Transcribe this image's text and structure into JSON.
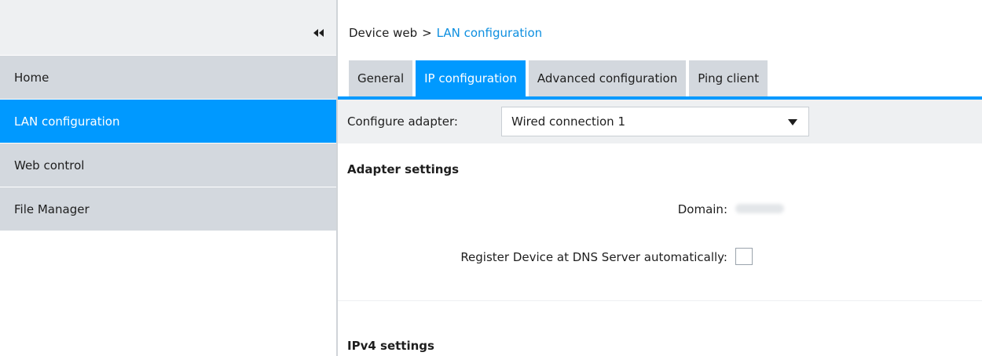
{
  "sidebar": {
    "items": [
      {
        "label": "Home",
        "active": false
      },
      {
        "label": "LAN configuration",
        "active": true
      },
      {
        "label": "Web control",
        "active": false
      },
      {
        "label": "File Manager",
        "active": false
      }
    ],
    "collapse_icon": "double-chevron-left-icon"
  },
  "breadcrumb": {
    "root": "Device web",
    "separator": ">",
    "current": "LAN configuration"
  },
  "tabs": [
    {
      "label": "General",
      "active": false
    },
    {
      "label": "IP configuration",
      "active": true
    },
    {
      "label": "Advanced configuration",
      "active": false
    },
    {
      "label": "Ping client",
      "active": false
    }
  ],
  "adapter": {
    "label": "Configure adapter:",
    "selected": "Wired connection 1"
  },
  "adapter_settings": {
    "title": "Adapter settings",
    "domain_label": "Domain:",
    "register_label": "Register Device at DNS Server automatically:",
    "register_checked": false
  },
  "ipv4": {
    "title": "IPv4 settings"
  },
  "colors": {
    "accent": "#0099ff",
    "nav_bg": "#d3d8de",
    "panel_bg": "#eef0f2"
  }
}
